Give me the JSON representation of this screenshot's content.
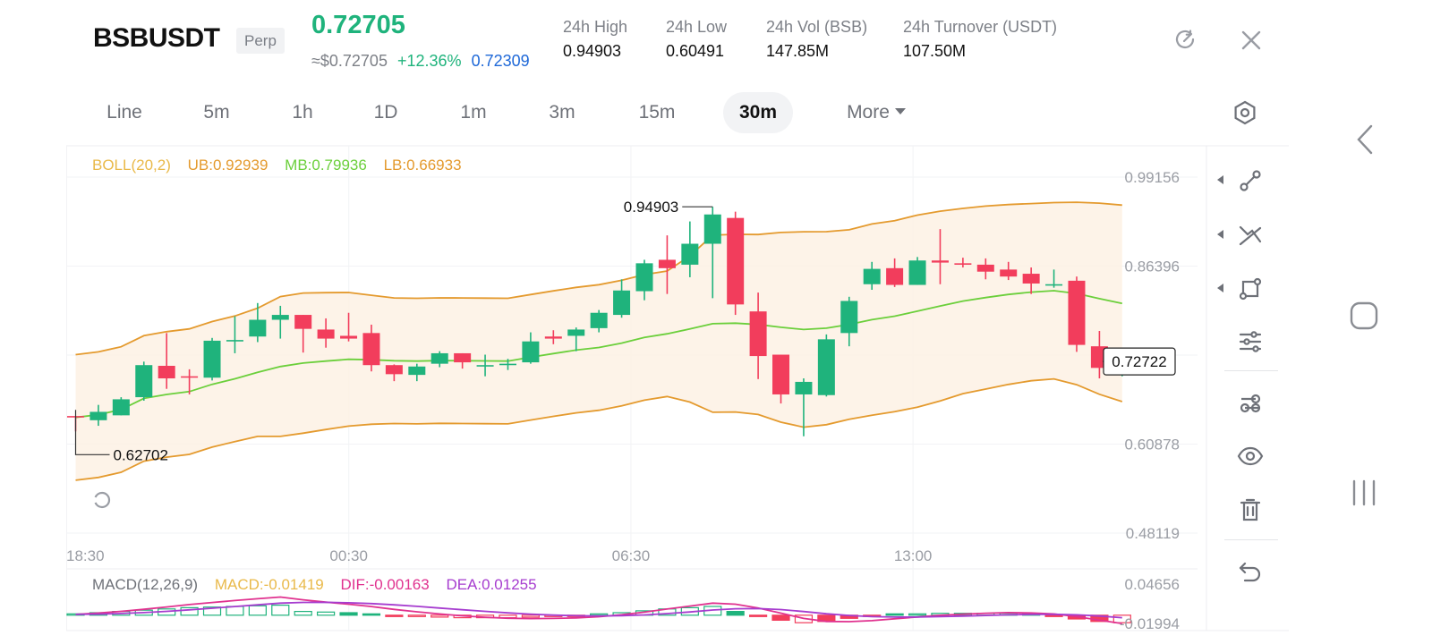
{
  "header": {
    "symbol": "BSBUSDT",
    "badge": "Perp",
    "last_price": "0.72705",
    "usd_price": "≈$0.72705",
    "change_pct": "+12.36%",
    "mark_price": "0.72309",
    "stats": [
      {
        "label": "24h   High",
        "value": "0.94903"
      },
      {
        "label": "24h   Low",
        "value": "0.60491"
      },
      {
        "label": "24h   Vol (BSB)",
        "value": "147.85M"
      },
      {
        "label": "24h   Turnover (USDT)",
        "value": "107.50M"
      }
    ],
    "icons": [
      "share-icon",
      "close-icon"
    ]
  },
  "tabs": [
    {
      "label": "Line",
      "active": false
    },
    {
      "label": "5m",
      "active": false
    },
    {
      "label": "1h",
      "active": false
    },
    {
      "label": "1D",
      "active": false
    },
    {
      "label": "1m",
      "active": false
    },
    {
      "label": "3m",
      "active": false
    },
    {
      "label": "15m",
      "active": false
    },
    {
      "label": "30m",
      "active": true
    },
    {
      "label": "More",
      "active": false
    }
  ],
  "boll_legend": {
    "name": "BOLL(20,2)",
    "ub": "UB:0.92939",
    "mb": "MB:0.79936",
    "lb": "LB:0.66933"
  },
  "macd_legend": {
    "name": "MACD(12,26,9)",
    "macd": "MACD:-0.01419",
    "dif": "DIF:-0.00163",
    "dea": "DEA:0.01255"
  },
  "colors": {
    "up": "#1fb37c",
    "down": "#f23d5c",
    "boll_name": "#e9b949",
    "ub": "#e49a2e",
    "mb": "#6bcf3b",
    "lb": "#e49a2e",
    "dif": "#e0328f",
    "dea": "#a63ccf",
    "mark": "#1e68d8"
  },
  "chart_data": {
    "type": "candlestick",
    "price_axis_labels": [
      "0.99156",
      "0.86396",
      "0.60878",
      "0.48119"
    ],
    "time_labels": [
      "18:30",
      "00:30",
      "06:30",
      "13:00"
    ],
    "high_marker": "0.94903",
    "low_marker": "0.62702",
    "current_price_label": "0.72722",
    "macd_axis_labels": [
      "0.04656",
      "-0.01994"
    ],
    "candles": [
      {
        "o": 0.649,
        "h": 0.649,
        "l": 0.627,
        "c": 0.647
      },
      {
        "o": 0.643,
        "h": 0.665,
        "l": 0.635,
        "c": 0.655
      },
      {
        "o": 0.65,
        "h": 0.676,
        "l": 0.65,
        "c": 0.673
      },
      {
        "o": 0.676,
        "h": 0.727,
        "l": 0.671,
        "c": 0.722
      },
      {
        "o": 0.721,
        "h": 0.768,
        "l": 0.688,
        "c": 0.703
      },
      {
        "o": 0.706,
        "h": 0.716,
        "l": 0.68,
        "c": 0.704
      },
      {
        "o": 0.704,
        "h": 0.761,
        "l": 0.7,
        "c": 0.757
      },
      {
        "o": 0.757,
        "h": 0.792,
        "l": 0.739,
        "c": 0.758
      },
      {
        "o": 0.763,
        "h": 0.811,
        "l": 0.755,
        "c": 0.787
      },
      {
        "o": 0.787,
        "h": 0.807,
        "l": 0.76,
        "c": 0.794
      },
      {
        "o": 0.794,
        "h": 0.794,
        "l": 0.74,
        "c": 0.774
      },
      {
        "o": 0.773,
        "h": 0.789,
        "l": 0.747,
        "c": 0.76
      },
      {
        "o": 0.764,
        "h": 0.797,
        "l": 0.756,
        "c": 0.76
      },
      {
        "o": 0.768,
        "h": 0.78,
        "l": 0.713,
        "c": 0.722
      },
      {
        "o": 0.722,
        "h": 0.723,
        "l": 0.699,
        "c": 0.709
      },
      {
        "o": 0.708,
        "h": 0.724,
        "l": 0.699,
        "c": 0.72
      },
      {
        "o": 0.724,
        "h": 0.742,
        "l": 0.719,
        "c": 0.739
      },
      {
        "o": 0.739,
        "h": 0.739,
        "l": 0.717,
        "c": 0.726
      },
      {
        "o": 0.722,
        "h": 0.737,
        "l": 0.706,
        "c": 0.722
      },
      {
        "o": 0.722,
        "h": 0.731,
        "l": 0.715,
        "c": 0.724
      },
      {
        "o": 0.726,
        "h": 0.769,
        "l": 0.724,
        "c": 0.756
      },
      {
        "o": 0.763,
        "h": 0.772,
        "l": 0.752,
        "c": 0.76
      },
      {
        "o": 0.764,
        "h": 0.776,
        "l": 0.742,
        "c": 0.773
      },
      {
        "o": 0.775,
        "h": 0.801,
        "l": 0.769,
        "c": 0.797
      },
      {
        "o": 0.794,
        "h": 0.845,
        "l": 0.79,
        "c": 0.829
      },
      {
        "o": 0.828,
        "h": 0.873,
        "l": 0.815,
        "c": 0.868
      },
      {
        "o": 0.873,
        "h": 0.908,
        "l": 0.824,
        "c": 0.861
      },
      {
        "o": 0.866,
        "h": 0.928,
        "l": 0.848,
        "c": 0.896
      },
      {
        "o": 0.896,
        "h": 0.949,
        "l": 0.818,
        "c": 0.938
      },
      {
        "o": 0.933,
        "h": 0.942,
        "l": 0.794,
        "c": 0.809
      },
      {
        "o": 0.799,
        "h": 0.826,
        "l": 0.702,
        "c": 0.735
      },
      {
        "o": 0.737,
        "h": 0.737,
        "l": 0.667,
        "c": 0.68
      },
      {
        "o": 0.68,
        "h": 0.703,
        "l": 0.62,
        "c": 0.698
      },
      {
        "o": 0.679,
        "h": 0.766,
        "l": 0.677,
        "c": 0.759
      },
      {
        "o": 0.768,
        "h": 0.82,
        "l": 0.749,
        "c": 0.814
      },
      {
        "o": 0.838,
        "h": 0.87,
        "l": 0.83,
        "c": 0.86
      },
      {
        "o": 0.861,
        "h": 0.875,
        "l": 0.834,
        "c": 0.837
      },
      {
        "o": 0.837,
        "h": 0.877,
        "l": 0.837,
        "c": 0.872
      },
      {
        "o": 0.872,
        "h": 0.917,
        "l": 0.838,
        "c": 0.869
      },
      {
        "o": 0.868,
        "h": 0.876,
        "l": 0.862,
        "c": 0.866
      },
      {
        "o": 0.866,
        "h": 0.875,
        "l": 0.845,
        "c": 0.856
      },
      {
        "o": 0.859,
        "h": 0.87,
        "l": 0.844,
        "c": 0.849
      },
      {
        "o": 0.853,
        "h": 0.862,
        "l": 0.824,
        "c": 0.839
      },
      {
        "o": 0.838,
        "h": 0.859,
        "l": 0.833,
        "c": 0.838
      },
      {
        "o": 0.843,
        "h": 0.849,
        "l": 0.741,
        "c": 0.751
      },
      {
        "o": 0.749,
        "h": 0.771,
        "l": 0.703,
        "c": 0.718
      },
      {
        "o": 0.714,
        "h": 0.736,
        "l": 0.706,
        "c": 0.727
      }
    ],
    "macd_hist": [
      0.002,
      0.004,
      0.006,
      0.008,
      0.01,
      0.012,
      0.013,
      0.014,
      0.015,
      0.016,
      0.006,
      0.005,
      0.004,
      0.002,
      -0.001,
      -0.002,
      -0.003,
      -0.004,
      -0.004,
      -0.004,
      -0.003,
      -0.002,
      -0.001,
      0.001,
      0.004,
      0.007,
      0.01,
      0.012,
      0.014,
      0.006,
      -0.002,
      -0.008,
      -0.012,
      -0.01,
      -0.005,
      -0.002,
      0.001,
      0.002,
      0.003,
      0.003,
      0.003,
      0.003,
      0.001,
      -0.001,
      -0.006,
      -0.01,
      -0.012
    ]
  },
  "tools": [
    "connect-nodes-icon",
    "trend-line-icon",
    "rectangle-icon",
    "indicators-icon",
    "layers-icon",
    "eye-icon",
    "trash-icon",
    "undo-icon"
  ],
  "system_nav": [
    "back-icon",
    "home-icon",
    "recents-icon"
  ]
}
